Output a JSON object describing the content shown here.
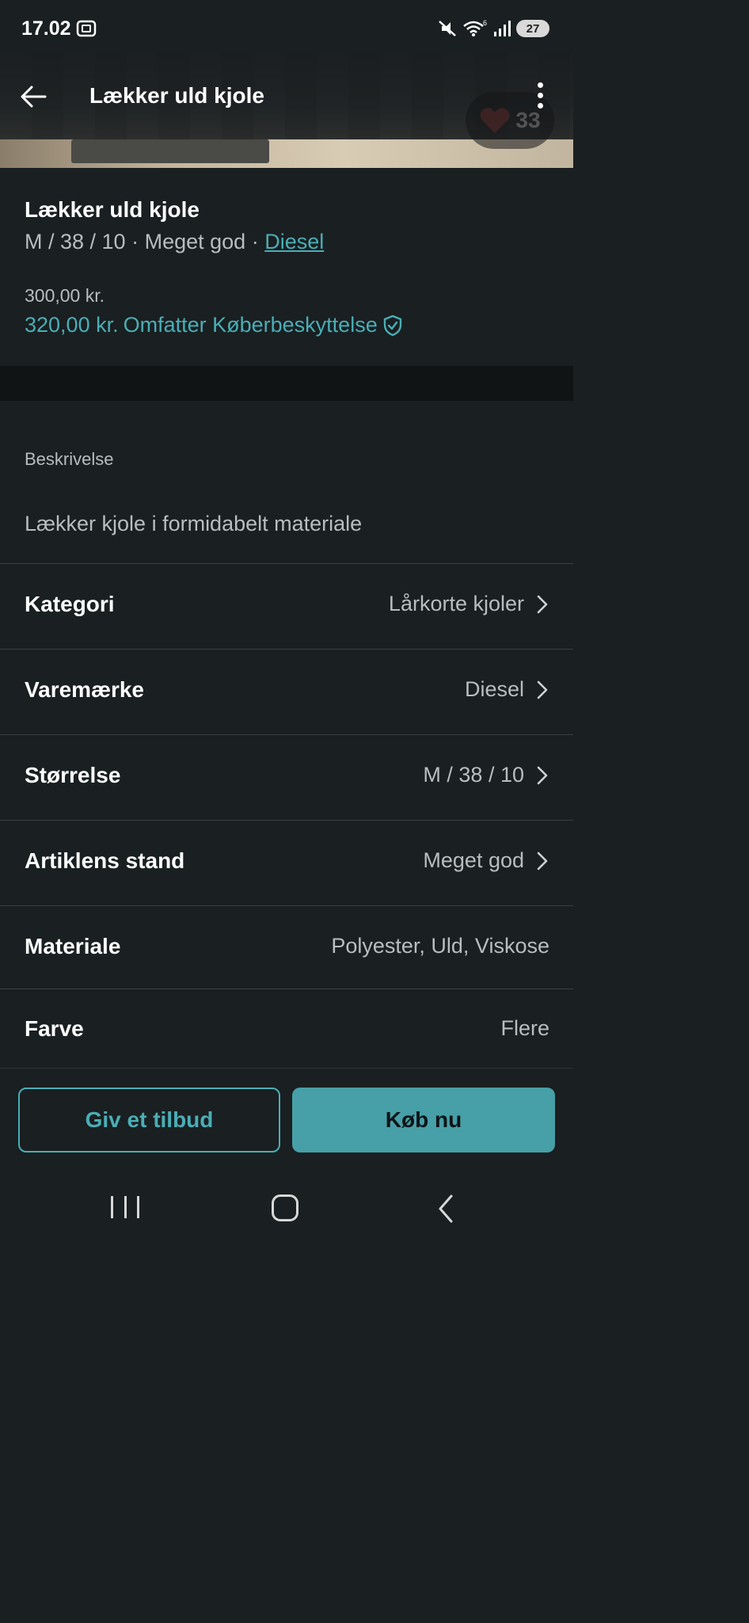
{
  "status_bar": {
    "time": "17.02",
    "battery": "27"
  },
  "app_bar": {
    "title": "Lækker uld kjole",
    "favorite_count": "33"
  },
  "item": {
    "title": "Lækker uld kjole",
    "size": "M / 38 / 10",
    "separator": "·",
    "condition": "Meget god",
    "brand": "Diesel",
    "price": "300,00 kr.",
    "price_with_protection": "320,00 kr.",
    "protection_label": "Omfatter Køberbeskyttelse"
  },
  "description": {
    "label": "Beskrivelse",
    "text": "Lækker kjole i formidabelt materiale"
  },
  "attributes": [
    {
      "label": "Kategori",
      "value": "Lårkorte kjoler",
      "chevron": true
    },
    {
      "label": "Varemærke",
      "value": "Diesel",
      "chevron": true
    },
    {
      "label": "Størrelse",
      "value": "M / 38 / 10",
      "chevron": true
    },
    {
      "label": "Artiklens stand",
      "value": "Meget god",
      "chevron": true
    },
    {
      "label": "Materiale",
      "value": "Polyester, Uld, Viskose",
      "chevron": false
    },
    {
      "label": "Farve",
      "value": "Flere",
      "chevron": false
    }
  ],
  "actions": {
    "offer_label": "Giv et tilbud",
    "buy_label": "Køb nu"
  },
  "colors": {
    "background": "#1a1f21",
    "accent": "#4aaeb6",
    "buy_button": "#479fa7",
    "muted_text": "#b9bdbf"
  },
  "icons": {
    "back": "arrow-left-icon",
    "more": "more-vertical-icon",
    "favorite": "heart-icon",
    "protection": "shield-check-icon",
    "chevron": "chevron-right-icon"
  }
}
